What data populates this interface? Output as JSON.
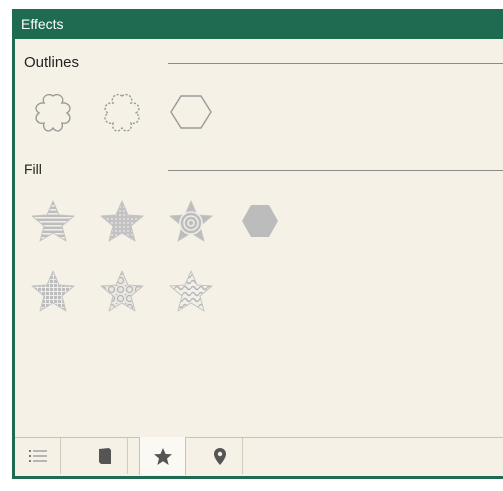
{
  "panel": {
    "title": "Effects",
    "sections": {
      "outlines_label": "Outlines",
      "fill_label": "Fill"
    },
    "outlines": [
      {
        "icon": "flower-outline-icon"
      },
      {
        "icon": "scalloped-flower-outline-icon"
      },
      {
        "icon": "hexagon-outline-icon"
      }
    ],
    "fills": [
      {
        "icon": "star-stripes-fill-icon"
      },
      {
        "icon": "star-dots-fill-icon"
      },
      {
        "icon": "star-concentric-fill-icon"
      },
      {
        "icon": "hexagon-solid-fill-icon"
      },
      {
        "icon": "star-grid-fill-icon"
      },
      {
        "icon": "star-floral-fill-icon"
      },
      {
        "icon": "star-waves-fill-icon"
      }
    ],
    "tabs": [
      {
        "icon": "list-icon",
        "active": false
      },
      {
        "icon": "book-icon",
        "active": false
      },
      {
        "icon": "star-icon",
        "active": true
      },
      {
        "icon": "map-pin-icon",
        "active": false
      }
    ]
  },
  "colors": {
    "title_bar": "#1e6b52",
    "panel_bg": "#f5f1e6",
    "icon_gray": "#b9b9b9",
    "tab_icon": "#555555"
  }
}
